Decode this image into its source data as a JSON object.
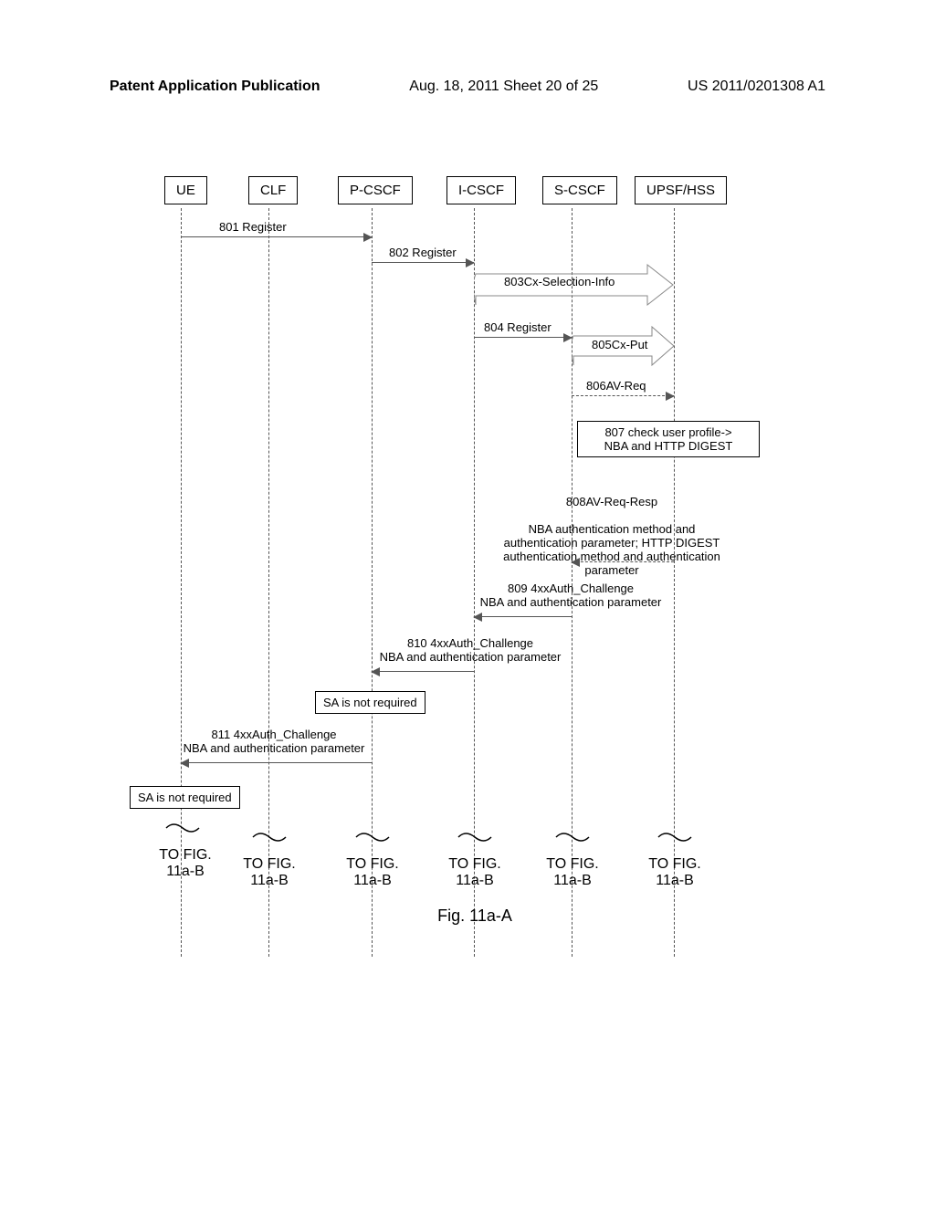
{
  "header": {
    "left": "Patent Application Publication",
    "middle": "Aug. 18, 2011  Sheet 20 of 25",
    "right": "US 2011/0201308 A1"
  },
  "actors": {
    "ue": "UE",
    "clf": "CLF",
    "pcscf": "P-CSCF",
    "icscf": "I-CSCF",
    "scscf": "S-CSCF",
    "upsf": "UPSF/HSS"
  },
  "messages": {
    "m801": "801 Register",
    "m802": "802 Register",
    "m803": "803Cx-Selection-Info",
    "m804": "804 Register",
    "m805": "805Cx-Put",
    "m806": "806AV-Req",
    "m807": "807 check user profile->\nNBA and HTTP DIGEST",
    "m808_title": "808AV-Req-Resp",
    "m808_body": "NBA authentication method and\nauthentication parameter; HTTP DIGEST\nauthentication method and authentication\nparameter",
    "m809_title": "809 4xxAuth_Challenge",
    "m809_body": "NBA and authentication parameter",
    "m810_title": "810 4xxAuth_Challenge",
    "m810_body": "NBA and authentication parameter",
    "m811_title": "811 4xxAuth_Challenge",
    "m811_body": "NBA and authentication parameter"
  },
  "notes": {
    "sa1": "SA is not required",
    "sa2": "SA is not required"
  },
  "continuations": {
    "c1": "TO FIG.\n11a-B",
    "c2": "TO FIG.\n11a-B",
    "c3": "TO FIG.\n11a-B",
    "c4": "TO FIG.\n11a-B",
    "c5": "TO FIG.\n11a-B",
    "c6": "TO FIG.\n11a-B"
  },
  "figure_label": "Fig. 11a-A"
}
